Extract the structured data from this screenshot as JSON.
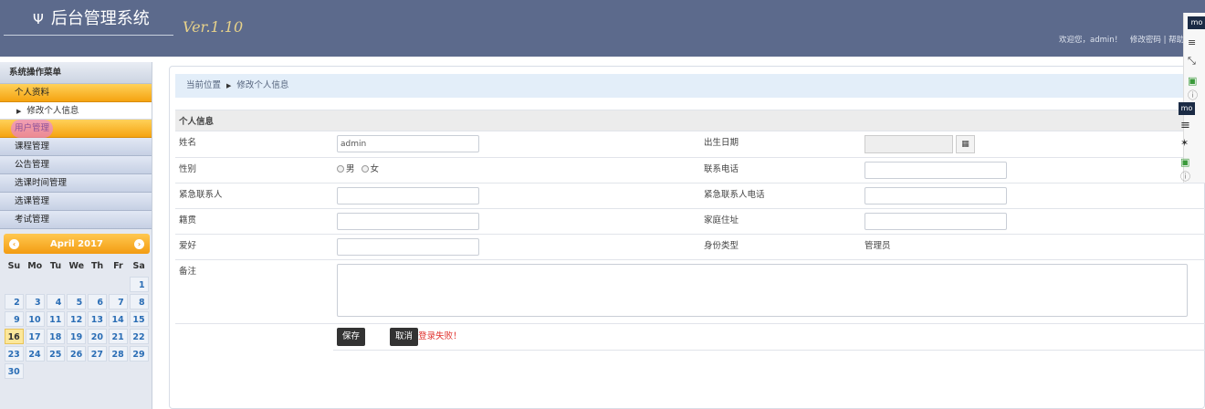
{
  "header": {
    "title": "后台管理系统",
    "logo_glyph": "Ψ",
    "version": "Ver.1.10",
    "welcome": "欢迎您，admin！",
    "change_password": "修改密码",
    "link_sep": "|",
    "link_partial": "帮助"
  },
  "sidebar": {
    "title": "系统操作菜单",
    "groups": [
      {
        "label": "个人资料",
        "active": true
      },
      {
        "label": "用户管理",
        "active": true
      },
      {
        "label": "课程管理"
      },
      {
        "label": "公告管理"
      },
      {
        "label": "选课时间管理"
      },
      {
        "label": "选课管理"
      },
      {
        "label": "考试管理"
      }
    ],
    "sub_item": "修改个人信息"
  },
  "calendar": {
    "month_label": "April 2017",
    "prev": "‹",
    "next": "›",
    "weekdays": [
      "Su",
      "Mo",
      "Tu",
      "We",
      "Th",
      "Fr",
      "Sa"
    ],
    "leading_blanks": 6,
    "days": [
      "1",
      "2",
      "3",
      "4",
      "5",
      "6",
      "7",
      "8",
      "9",
      "10",
      "11",
      "12",
      "13",
      "14",
      "15",
      "16",
      "17",
      "18",
      "19",
      "20",
      "21",
      "22",
      "23",
      "24",
      "25",
      "26",
      "27",
      "28",
      "29",
      "30"
    ],
    "today": "16"
  },
  "breadcrumb": {
    "home": "当前位置",
    "current": "修改个人信息"
  },
  "form": {
    "section": "个人信息",
    "name_label": "姓名",
    "name_value": "admin",
    "birth_label": "出生日期",
    "gender_label": "性别",
    "gender_male": "男",
    "gender_female": "女",
    "phone_label": "联系电话",
    "emergency_label": "紧急联系人",
    "emergency_phone_label": "紧急联系人电话",
    "origin_label": "籍贯",
    "address_label": "家庭住址",
    "hobby_label": "爱好",
    "identity_label": "身份类型",
    "identity_value": "管理员",
    "remark_label": "备注",
    "save": "保存",
    "cancel": "取消",
    "error": "登录失败！"
  },
  "toolbar": {
    "badge": "mo"
  }
}
